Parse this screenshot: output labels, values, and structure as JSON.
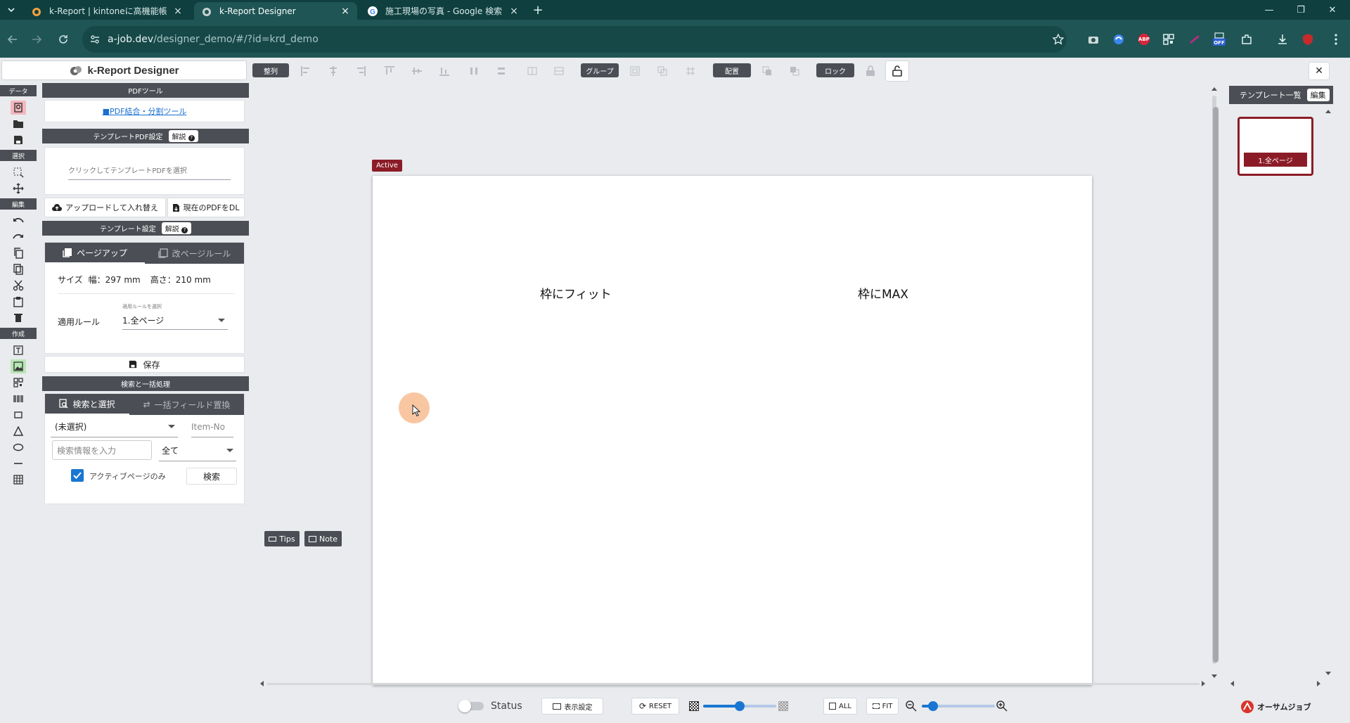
{
  "browser": {
    "tabs": [
      {
        "title": "k-Report | kintoneに高機能帳票",
        "active": false
      },
      {
        "title": "k-Report Designer",
        "active": true
      },
      {
        "title": "施工現場の写真 - Google 検索",
        "active": false
      }
    ],
    "new_tab": "+",
    "url_host": "a-job.dev",
    "url_path": "/designer_demo/#/?id=krd_demo",
    "ext_icons": [
      "camera-icon",
      "copilot-icon",
      "adblock-icon",
      "qr-icon",
      "link-icon",
      "off-icon",
      "extensions-icon",
      "download-icon",
      "profile-icon",
      "menu-icon"
    ],
    "ext_labels": {
      "adblock": "ABP",
      "off": "OFF"
    }
  },
  "app": {
    "title": "k-Report Designer",
    "toolbar": {
      "align_label": "整列",
      "group_label": "グループ",
      "arrange_label": "配置",
      "lock_label": "ロック"
    },
    "rail": {
      "data": "データ",
      "select": "選択",
      "edit": "編集",
      "create": "作成"
    },
    "pdf_tools": {
      "header": "PDFツール",
      "link": "■PDF結合・分割ツール"
    },
    "template_pdf": {
      "header": "テンプレートPDF設定",
      "help": "解説",
      "placeholder": "クリックしてテンプレートPDFを選択",
      "upload_btn": "アップロードして入れ替え",
      "download_btn": "現在のPDFをDL"
    },
    "template_settings": {
      "header": "テンプレート設定",
      "help": "解説",
      "tab_pageup": "ページアップ",
      "tab_pagebreak": "改ページルール",
      "size_label": "サイズ",
      "width_text": "幅：297 mm",
      "height_text": "高さ：210 mm",
      "rule_hint": "適用ルールを選択",
      "rule_label": "適用ルール",
      "rule_value": "1.全ページ",
      "save": "保存"
    },
    "search": {
      "header": "検索と一括処理",
      "tab_search": "検索と選択",
      "tab_replace": "一括フィールド置換",
      "field_value": "(未選択)",
      "item_no_placeholder": "Item-No",
      "query_placeholder": "検索情報を入力",
      "scope_value": "全て",
      "active_only": "アクティブページのみ",
      "active_only_checked": true,
      "search_btn": "検索"
    },
    "canvas": {
      "badge": "Active",
      "text1": "枠にフィット",
      "text2": "枠にMAX",
      "tips": "Tips",
      "note": "Note"
    },
    "templates": {
      "header": "テンプレート一覧",
      "edit": "編集",
      "pages": [
        "1.全ページ"
      ]
    },
    "bottom": {
      "status": "Status",
      "display": "表示設定",
      "reset": "RESET",
      "all": "ALL",
      "fit": "FIT",
      "logo": "オーサムジョブ"
    }
  },
  "colors": {
    "chrome_tabbar": "#0f3f3f",
    "chrome_addr": "#1f5555",
    "dark_header": "#4b4e54",
    "accent_red": "#8b1c27",
    "slider_blue": "#1976d2"
  }
}
